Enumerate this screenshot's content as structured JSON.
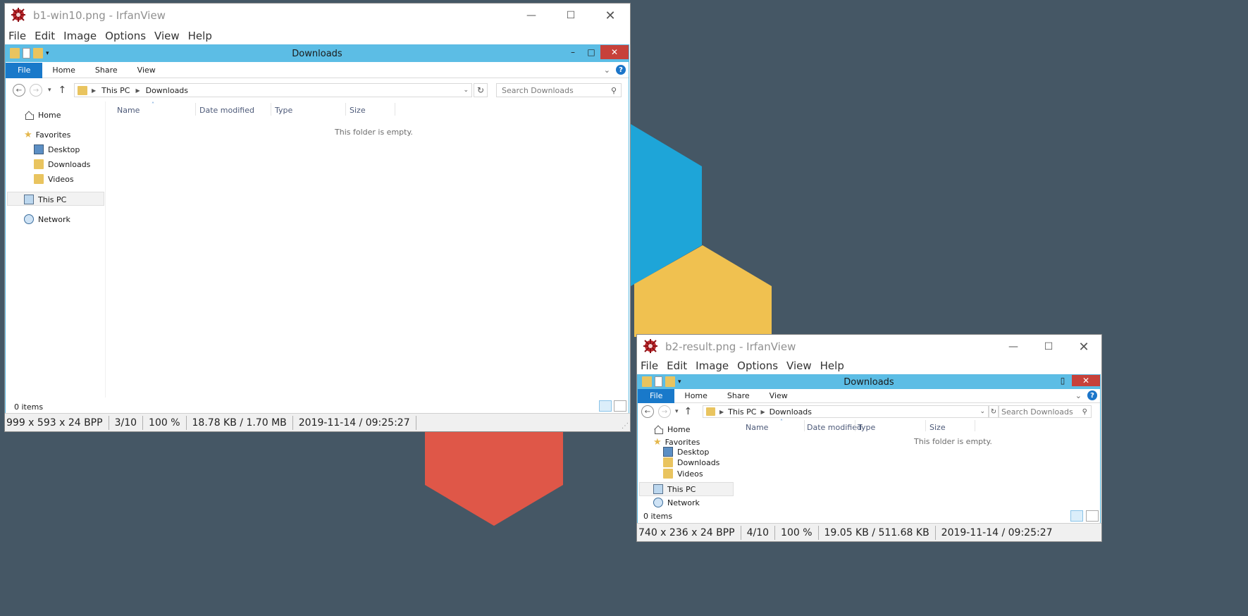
{
  "background": {
    "color": "#455765",
    "hex_colors": [
      "#1ea5d8",
      "#f0c150",
      "#df5748"
    ]
  },
  "window1": {
    "title": "b1-win10.png - IrfanView",
    "menu": [
      "File",
      "Edit",
      "Image",
      "Options",
      "View",
      "Help"
    ],
    "status": [
      "999 x 593 x 24 BPP",
      "3/10",
      "100 %",
      "18.78 KB / 1.70 MB",
      "2019-11-14 / 09:25:27"
    ]
  },
  "window2": {
    "title": "b2-result.png - IrfanView",
    "menu": [
      "File",
      "Edit",
      "Image",
      "Options",
      "View",
      "Help"
    ],
    "status": [
      "740 x 236 x 24 BPP",
      "4/10",
      "100 %",
      "19.05 KB / 511.68 KB",
      "2019-11-14 / 09:25:27"
    ]
  },
  "explorer": {
    "title": "Downloads",
    "ribbon_tabs": [
      "File",
      "Home",
      "Share",
      "View"
    ],
    "breadcrumb": [
      "This PC",
      "Downloads"
    ],
    "search_placeholder": "Search Downloads",
    "nav": {
      "home": "Home",
      "favorites": "Favorites",
      "desktop": "Desktop",
      "downloads": "Downloads",
      "videos": "Videos",
      "this_pc": "This PC",
      "network": "Network"
    },
    "columns": [
      "Name",
      "Date modified",
      "Type",
      "Size"
    ],
    "empty_message": "This folder is empty.",
    "item_count": "0 items"
  }
}
